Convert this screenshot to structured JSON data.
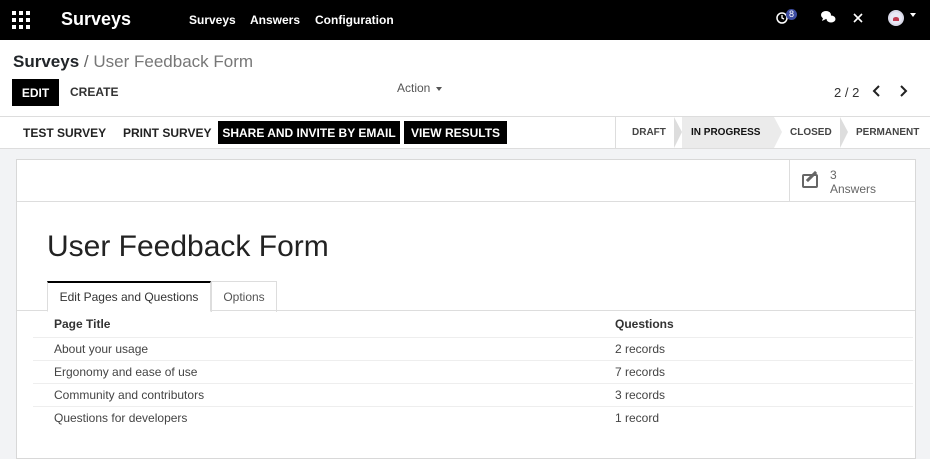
{
  "navbar": {
    "brand": "Surveys",
    "menu": [
      {
        "label": "Surveys"
      },
      {
        "label": "Answers"
      },
      {
        "label": "Configuration"
      }
    ],
    "activity_count": "8"
  },
  "control": {
    "breadcrumb_root": "Surveys",
    "breadcrumb_sep": "/",
    "breadcrumb_current": "User Feedback Form",
    "edit_label": "EDIT",
    "create_label": "CREATE",
    "action_label": "Action",
    "pager": "2 / 2"
  },
  "statusbar": {
    "test_survey": "TEST SURVEY",
    "print_survey": "PRINT SURVEY",
    "share_invite": "SHARE AND INVITE BY EMAIL",
    "view_results": "VIEW RESULTS",
    "stages": [
      {
        "label": "DRAFT",
        "active": false
      },
      {
        "label": "IN PROGRESS",
        "active": true
      },
      {
        "label": "CLOSED",
        "active": false
      },
      {
        "label": "PERMANENT",
        "active": false
      }
    ]
  },
  "sheet": {
    "answers_count": "3",
    "answers_label": "Answers",
    "title": "User Feedback Form",
    "tabs": [
      {
        "label": "Edit Pages and Questions",
        "active": true
      },
      {
        "label": "Options",
        "active": false
      }
    ],
    "table": {
      "headers": [
        "Page Title",
        "Questions"
      ],
      "rows": [
        {
          "title": "About your usage",
          "questions": "2 records"
        },
        {
          "title": "Ergonomy and ease of use",
          "questions": "7 records"
        },
        {
          "title": "Community and contributors",
          "questions": "3 records"
        },
        {
          "title": "Questions for developers",
          "questions": "1 record"
        }
      ]
    }
  }
}
